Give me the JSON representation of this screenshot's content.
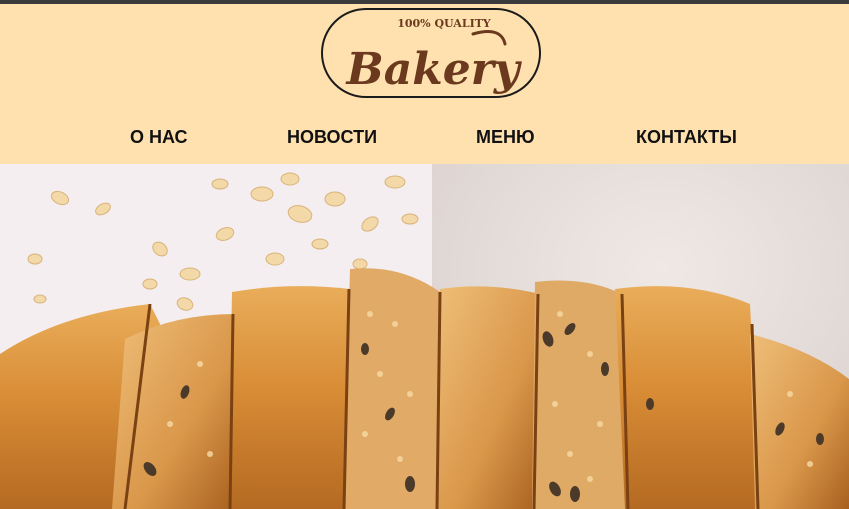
{
  "brand": {
    "tagline": "100% QUALITY",
    "name": "Bakery",
    "logo_color": "#6b3a1e"
  },
  "nav": {
    "items": [
      {
        "label": "О НАС"
      },
      {
        "label": "НОВОСТИ"
      },
      {
        "label": "МЕНЮ"
      },
      {
        "label": "КОНТАКТЫ"
      }
    ]
  },
  "colors": {
    "header_bg": "#ffe1b0",
    "top_strip": "#3b3b3b"
  }
}
